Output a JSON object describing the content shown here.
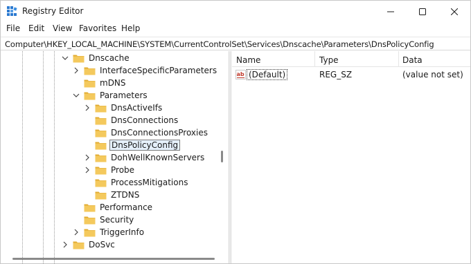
{
  "window": {
    "title": "Registry Editor"
  },
  "menu": {
    "file": "File",
    "edit": "Edit",
    "view": "View",
    "favorites": "Favorites",
    "help": "Help"
  },
  "address": "Computer\\HKEY_LOCAL_MACHINE\\SYSTEM\\CurrentControlSet\\Services\\Dnscache\\Parameters\\DnsPolicyConfig",
  "tree": {
    "items": [
      {
        "label": "Dnscache",
        "state": "expanded"
      },
      {
        "label": "InterfaceSpecificParameters",
        "state": "collapsed"
      },
      {
        "label": "mDNS",
        "state": "leaf"
      },
      {
        "label": "Parameters",
        "state": "expanded"
      },
      {
        "label": "DnsActiveIfs",
        "state": "collapsed"
      },
      {
        "label": "DnsConnections",
        "state": "leaf"
      },
      {
        "label": "DnsConnectionsProxies",
        "state": "leaf"
      },
      {
        "label": "DnsPolicyConfig",
        "state": "selected"
      },
      {
        "label": "DohWellKnownServers",
        "state": "collapsed"
      },
      {
        "label": "Probe",
        "state": "collapsed"
      },
      {
        "label": "ProcessMitigations",
        "state": "leaf"
      },
      {
        "label": "ZTDNS",
        "state": "leaf"
      },
      {
        "label": "Performance",
        "state": "leaf"
      },
      {
        "label": "Security",
        "state": "leaf"
      },
      {
        "label": "TriggerInfo",
        "state": "collapsed"
      },
      {
        "label": "DoSvc",
        "state": "collapsed"
      }
    ]
  },
  "list": {
    "columns": {
      "name": "Name",
      "type": "Type",
      "data": "Data"
    },
    "rows": [
      {
        "name": "(Default)",
        "type": "REG_SZ",
        "data": "(value not set)",
        "icon": "string-value-icon"
      }
    ]
  },
  "colors": {
    "folder": "#f4c95d",
    "folder_dark": "#e2ac32",
    "selection": "#e5f0fb",
    "ab_red": "#c0392b"
  }
}
